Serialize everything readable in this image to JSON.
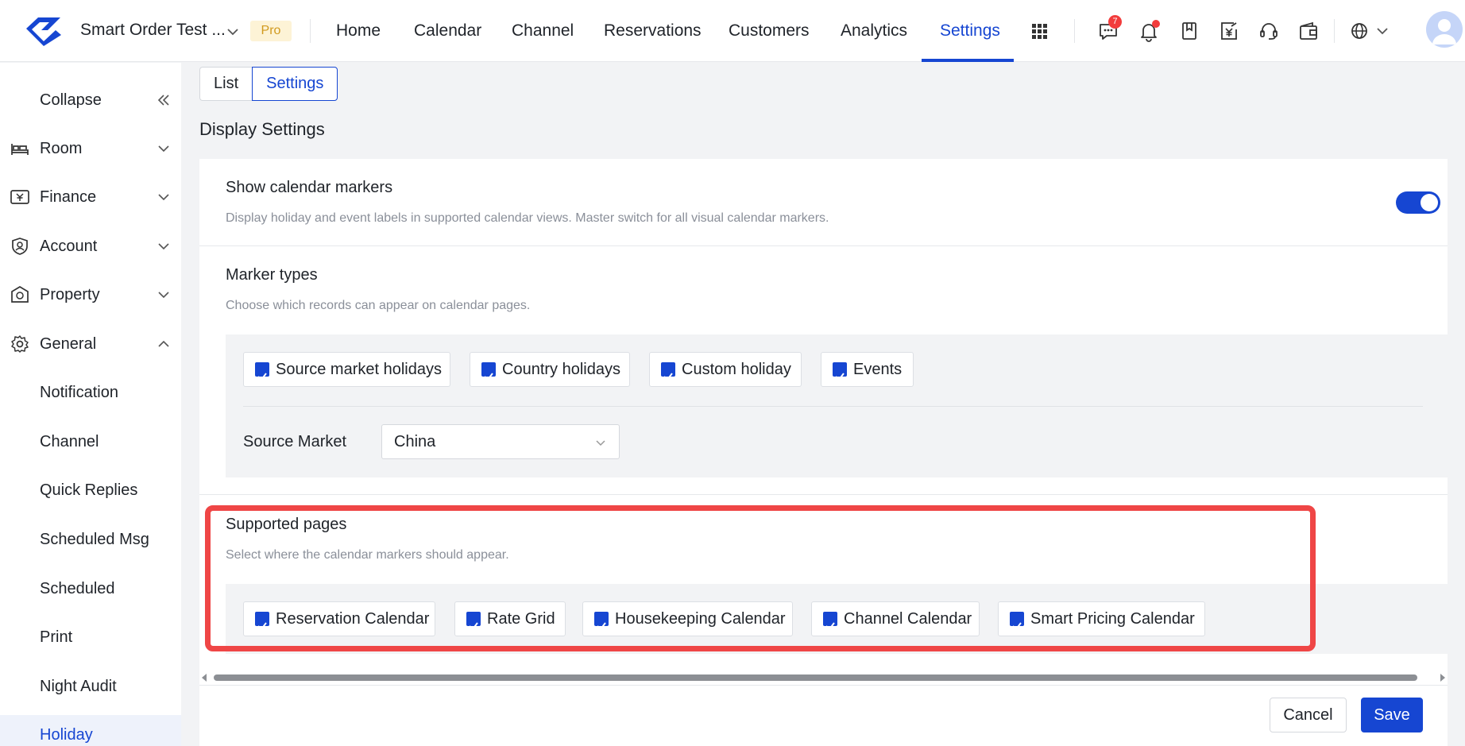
{
  "header": {
    "org_name": "Smart Order Test ...",
    "plan_badge": "Pro",
    "nav": [
      {
        "label": "Home"
      },
      {
        "label": "Calendar"
      },
      {
        "label": "Channel"
      },
      {
        "label": "Reservations"
      },
      {
        "label": "Customers"
      },
      {
        "label": "Analytics"
      },
      {
        "label": "Settings",
        "active": true
      }
    ],
    "message_badge_count": "7",
    "icons": [
      "apps-grid-icon",
      "message-icon",
      "bell-icon",
      "bookmark-icon",
      "invoice-yen-icon",
      "headset-icon",
      "wallet-icon",
      "globe-icon",
      "user-avatar"
    ]
  },
  "sidebar": {
    "collapse_label": "Collapse",
    "items": [
      {
        "label": "Room",
        "icon": "bed-icon",
        "expanded": false
      },
      {
        "label": "Finance",
        "icon": "finance-icon",
        "expanded": false
      },
      {
        "label": "Account",
        "icon": "shield-user-icon",
        "expanded": false
      },
      {
        "label": "Property",
        "icon": "property-icon",
        "expanded": false
      },
      {
        "label": "General",
        "icon": "gear-icon",
        "expanded": true
      }
    ],
    "sub_items": [
      {
        "label": "Notification"
      },
      {
        "label": "Channel"
      },
      {
        "label": "Quick Replies"
      },
      {
        "label": "Scheduled Msg"
      },
      {
        "label": "Scheduled"
      },
      {
        "label": "Print"
      },
      {
        "label": "Night Audit"
      },
      {
        "label": "Holiday",
        "active": true
      }
    ]
  },
  "main": {
    "tabs": [
      {
        "label": "List"
      },
      {
        "label": "Settings",
        "active": true
      }
    ],
    "title": "Display Settings",
    "show_markers": {
      "title": "Show calendar markers",
      "description": "Display holiday and event labels in supported calendar views. Master switch for all visual calendar markers.",
      "enabled": true
    },
    "marker_types": {
      "title": "Marker types",
      "description": "Choose which records can appear on calendar pages.",
      "options": [
        {
          "label": "Source market holidays",
          "checked": true
        },
        {
          "label": "Country holidays",
          "checked": true
        },
        {
          "label": "Custom holiday",
          "checked": true
        },
        {
          "label": "Events",
          "checked": true
        }
      ],
      "source_market_label": "Source Market",
      "source_market_value": "China"
    },
    "supported_pages": {
      "title": "Supported pages",
      "description": "Select where the calendar markers should appear.",
      "options": [
        {
          "label": "Reservation Calendar",
          "checked": true
        },
        {
          "label": "Rate Grid",
          "checked": true
        },
        {
          "label": "Housekeeping Calendar",
          "checked": true
        },
        {
          "label": "Channel Calendar",
          "checked": true
        },
        {
          "label": "Smart Pricing Calendar",
          "checked": true
        }
      ]
    }
  },
  "footer": {
    "cancel_label": "Cancel",
    "save_label": "Save"
  },
  "colors": {
    "accent": "#1646d2",
    "highlight": "#ef4646",
    "pro_badge": "#fdf3d6"
  }
}
